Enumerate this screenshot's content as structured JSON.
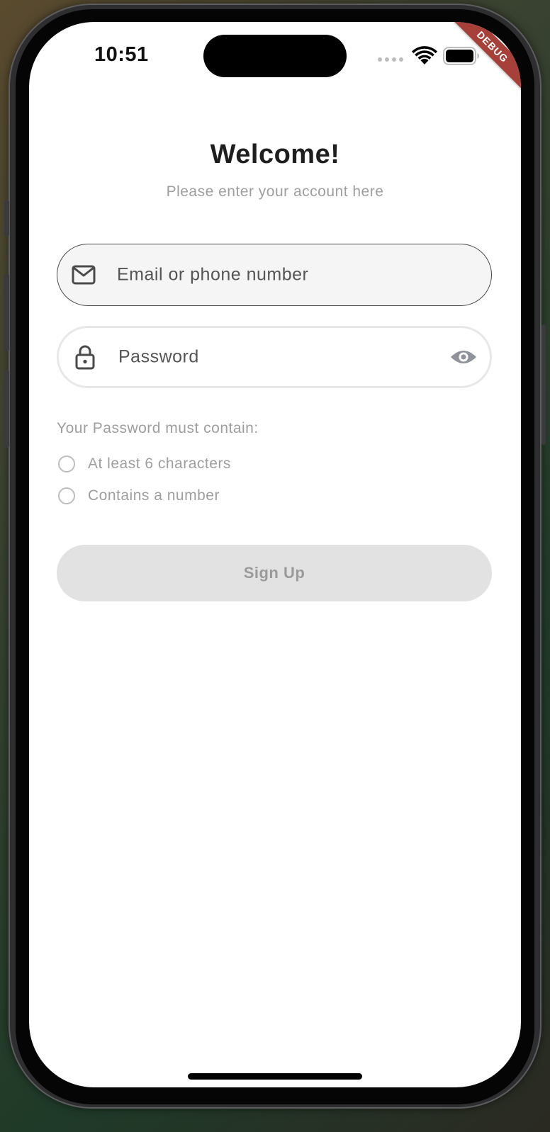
{
  "status_bar": {
    "time": "10:51",
    "debug_label": "DEBUG"
  },
  "header": {
    "title": "Welcome!",
    "subtitle": "Please enter your account here"
  },
  "form": {
    "email": {
      "placeholder": "Email or phone number",
      "value": "",
      "icon": "mail-icon"
    },
    "password": {
      "placeholder": "Password",
      "value": "",
      "icon": "lock-icon",
      "toggle_icon": "eye-icon"
    }
  },
  "requirements": {
    "title": "Your Password must contain:",
    "items": [
      {
        "label": "At least 6 characters",
        "met": false
      },
      {
        "label": "Contains a number",
        "met": false
      }
    ]
  },
  "actions": {
    "signup_label": "Sign Up",
    "signup_enabled": false
  },
  "colors": {
    "title": "#1e1e1e",
    "muted_text": "#9e9e9e",
    "disabled_button_bg": "#e2e2e2",
    "disabled_button_text": "#9a9a9a",
    "debug_banner": "#a8403a"
  }
}
